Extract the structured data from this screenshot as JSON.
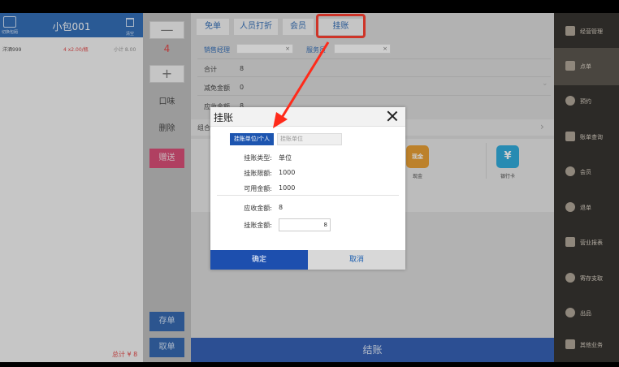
{
  "left": {
    "title": "小包001",
    "copy_label": "切换包厢",
    "trash_label": "清空",
    "item": {
      "name": "洋酒999",
      "qty": "4 x2.00/瓶",
      "sub": "小计 8.00"
    },
    "total": "总计 ¥ 8"
  },
  "actions": {
    "minus": "—",
    "qty": "4",
    "plus": "+",
    "flavor": "口味",
    "delete": "删除",
    "gift": "赠送",
    "save": "存单",
    "retrieve": "取单"
  },
  "main": {
    "tabs": [
      "免单",
      "人员打折",
      "会员",
      "挂账"
    ],
    "sales_manager_label": "销售经理",
    "waiter_label": "服务员",
    "clear_glyph": "×",
    "rows": [
      {
        "label": "合计",
        "value": "8"
      },
      {
        "label": "减免金额",
        "value": "0"
      },
      {
        "label": "应收金额",
        "value": "8"
      }
    ],
    "group_label": "组合",
    "pay_methods": [
      {
        "label": "现金",
        "glyph": "现金",
        "color": "#e6951e"
      },
      {
        "label": "银行卡",
        "glyph": "¥",
        "color": "#1aa2d8"
      }
    ],
    "checkout": "结账"
  },
  "nav": {
    "items": [
      "经营管理",
      "点单",
      "预约",
      "账单查询",
      "会员",
      "退单",
      "营业报表",
      "寄存支取",
      "出品",
      "其他业务"
    ],
    "active_index": 1
  },
  "dialog": {
    "title": "挂账",
    "account_button": "挂账单位/个人",
    "account_placeholder": "挂账单位",
    "type_label": "挂账类型:",
    "type_value": "单位",
    "limit_label": "挂账限额:",
    "limit_value": "1000",
    "available_label": "可用金额:",
    "available_value": "1000",
    "receivable_label": "应收金额:",
    "receivable_value": "8",
    "amount_label": "挂账金额:",
    "amount_value": "8",
    "ok": "确定",
    "cancel": "取消"
  },
  "colors": {
    "primary": "#1d5fb0",
    "highlight": "#ff2a1a",
    "gift": "#d63b68"
  }
}
